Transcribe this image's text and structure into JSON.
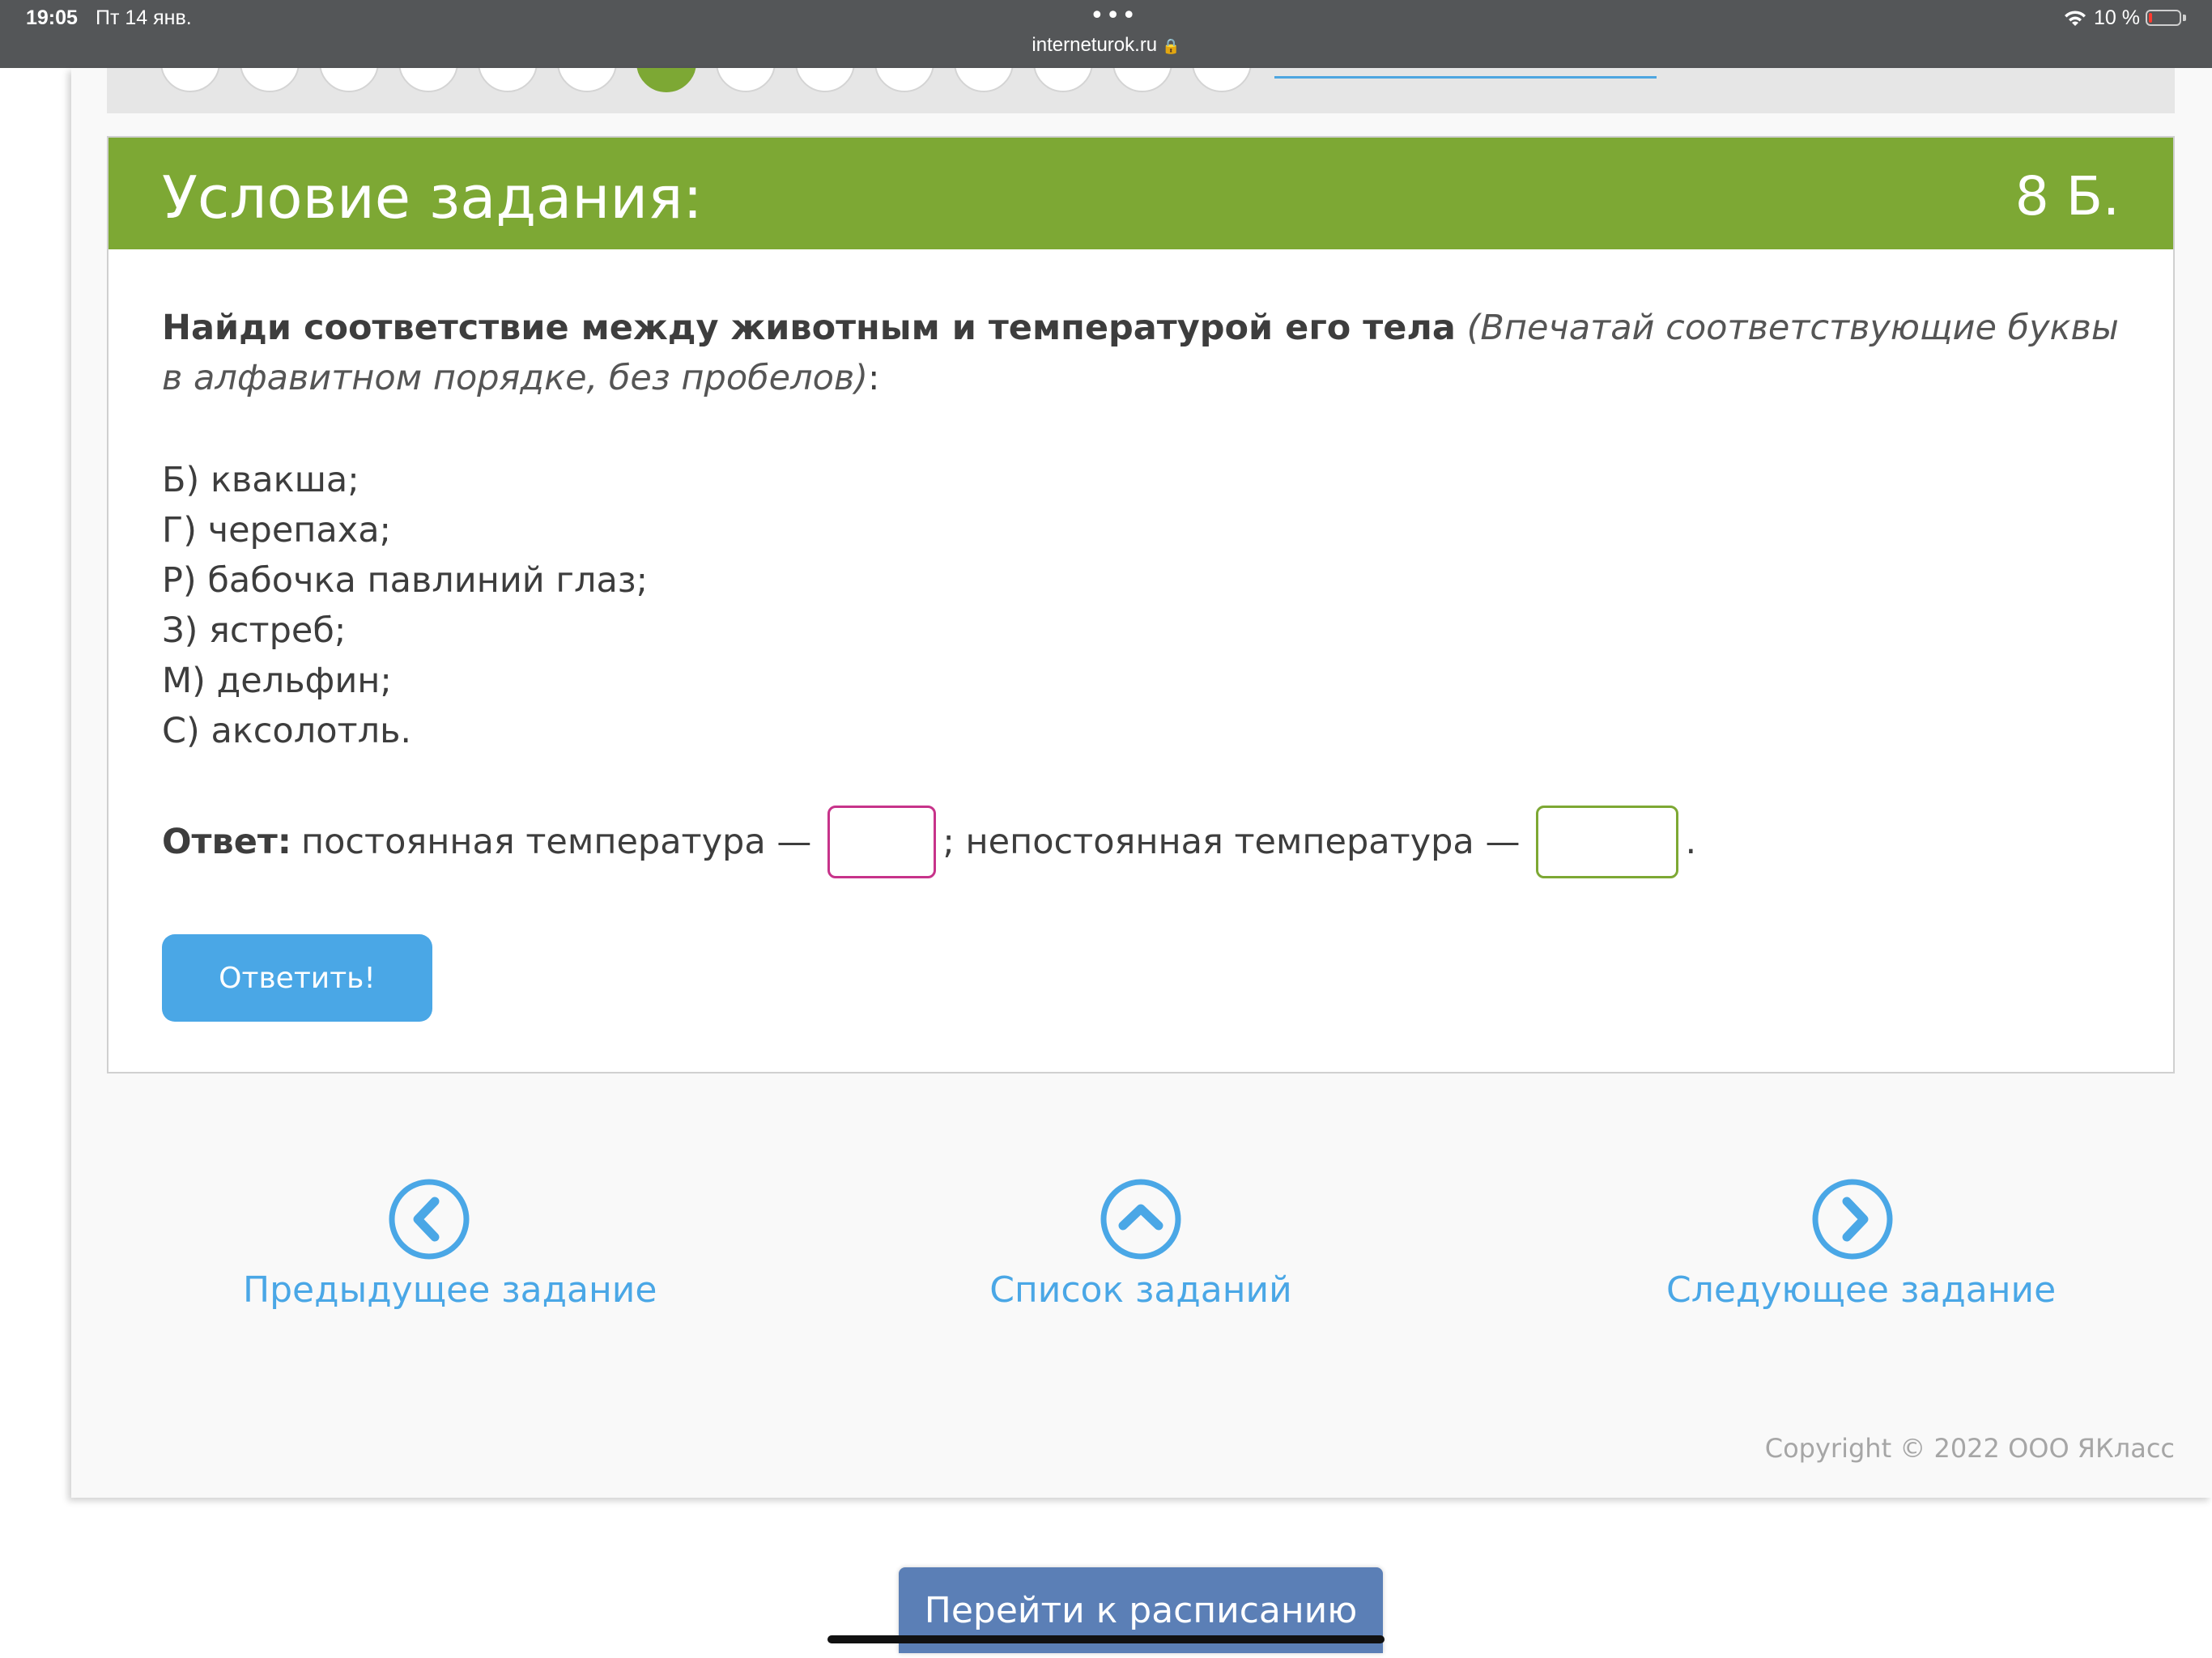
{
  "status_bar": {
    "time": "19:05",
    "date": "Пт 14 янв.",
    "url": "interneturok.ru",
    "battery_percent_label": "10 %",
    "battery_level": 0.1
  },
  "progress": {
    "total_circles": 14,
    "active_index": 6
  },
  "task": {
    "title": "Условие задания:",
    "points": "8 Б.",
    "instruction_bold": "Найди соответствие между животным и температурой его тела",
    "instruction_italic": "(Впечатай соответствующие буквы в алфавитном порядке, без пробелов)",
    "instruction_tail": ":",
    "options": [
      "Б) квакша;",
      "Г) черепаха;",
      "Р) бабочка павлиний глаз;",
      "З) ястреб;",
      "М) дельфин;",
      "С) аксолотль."
    ],
    "answer": {
      "label": "Ответ:",
      "part1": "постоянная температура —",
      "part2": "; непостоянная температура —",
      "end": ".",
      "value1": "",
      "value2": ""
    },
    "submit_label": "Ответить!"
  },
  "navigation": {
    "prev_label": "Предыдущее задание",
    "list_label": "Список заданий",
    "next_label": "Следующее задание"
  },
  "copyright": "Copyright © 2022 ООО ЯКласс",
  "schedule_button": "Перейти к расписанию",
  "colors": {
    "header_green": "#7da834",
    "link_blue": "#4aa7e6",
    "input_pink": "#c7338a",
    "schedule_blue": "#5b7fb6"
  }
}
